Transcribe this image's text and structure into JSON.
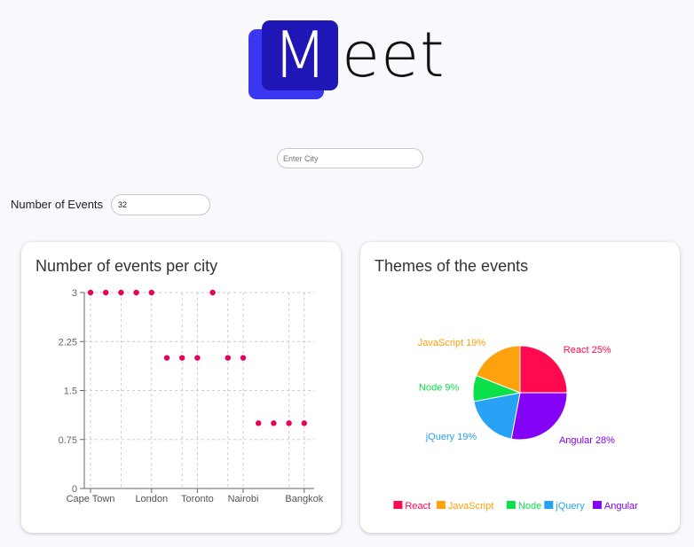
{
  "logo": {
    "initial": "M",
    "rest": "eet"
  },
  "search": {
    "placeholder": "Enter City"
  },
  "events_count": {
    "label": "Number of Events",
    "value": "32"
  },
  "charts": {
    "scatter_title": "Number of events per city",
    "pie_title": "Themes of the events"
  },
  "colors": {
    "accent_dark": "#1f17b5",
    "accent_light": "#3b36ef",
    "scatter_point": "#e8005a"
  },
  "chart_data": [
    {
      "type": "scatter",
      "title": "Number of events per city",
      "xlabel": "",
      "ylabel": "",
      "x": [
        "Cape Town",
        "",
        "",
        "",
        "London",
        "",
        "",
        "Toronto",
        "",
        "",
        "Nairobi",
        "",
        "",
        "",
        "Bangkok"
      ],
      "x_tick_labels": [
        "Cape Town",
        "London",
        "Toronto",
        "Nairobi",
        "Bangkok"
      ],
      "y": [
        3,
        3,
        3,
        3,
        3,
        2,
        2,
        2,
        3,
        2,
        2,
        1,
        1,
        1,
        1
      ],
      "yticks": [
        "0",
        "0.75",
        "1.5",
        "2.25",
        "3"
      ],
      "ylim": [
        0,
        3
      ],
      "grid": true
    },
    {
      "type": "pie",
      "title": "Themes of the events",
      "slices": [
        {
          "name": "React",
          "value": 25,
          "label": "React 25%",
          "color": "#ff0a4f"
        },
        {
          "name": "Angular",
          "value": 28,
          "label": "Angular 28%",
          "color": "#8402f5"
        },
        {
          "name": "jQuery",
          "value": 19,
          "label": "jQuery 19%",
          "color": "#27a2f5"
        },
        {
          "name": "Node",
          "value": 9,
          "label": "Node 9%",
          "color": "#0be04a"
        },
        {
          "name": "JavaScript",
          "value": 19,
          "label": "JavaScript 19%",
          "color": "#fda10c"
        }
      ],
      "legend": [
        "React",
        "JavaScript",
        "Node",
        "jQuery",
        "Angular"
      ],
      "legend_placement": "bottom"
    }
  ]
}
